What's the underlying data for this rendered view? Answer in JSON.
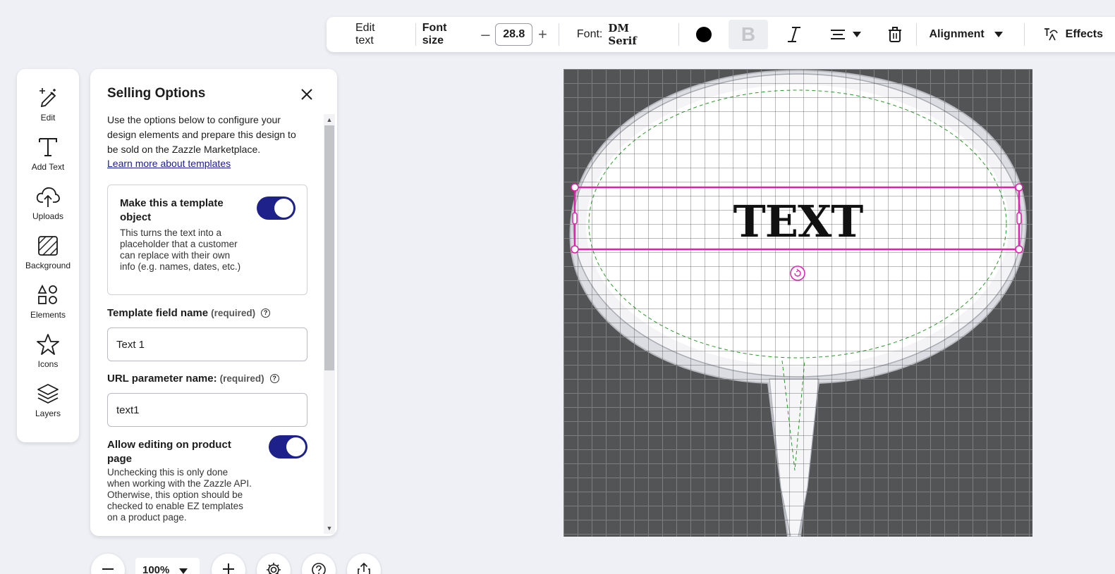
{
  "toolbar": {
    "edit_text": "Edit text",
    "font_size_label": "Font size",
    "font_size_value": "28.8",
    "font_label": "Font:",
    "font_name": "DM Serif",
    "text_color": "#000000",
    "bold_glyph": "B",
    "alignment_label": "Alignment",
    "effects_label": "Effects"
  },
  "rail": {
    "items": [
      {
        "label": "Edit",
        "icon": "edit-sparkle-icon"
      },
      {
        "label": "Add Text",
        "icon": "text-icon"
      },
      {
        "label": "Uploads",
        "icon": "cloud-upload-icon"
      },
      {
        "label": "Background",
        "icon": "background-icon"
      },
      {
        "label": "Elements",
        "icon": "shapes-icon"
      },
      {
        "label": "Icons",
        "icon": "star-icon"
      },
      {
        "label": "Layers",
        "icon": "layers-icon"
      }
    ]
  },
  "panel": {
    "title": "Selling Options",
    "intro": "Use the options below to configure your design elements and prepare this design to be sold on the Zazzle Marketplace.",
    "learn_link": "Learn more about templates",
    "template_toggle": {
      "title": "Make this a template object",
      "description": "This turns the text into a placeholder that a customer can replace with their own info (e.g. names, dates, etc.)",
      "enabled": true
    },
    "template_field": {
      "label": "Template field name",
      "required": "(required)",
      "value": "Text 1"
    },
    "url_param": {
      "label": "URL parameter name:",
      "required": "(required)",
      "value": "text1"
    },
    "allow_editing": {
      "title": "Allow editing on product page",
      "description": "Unchecking this is only done when working with the Zazzle API. Otherwise, this option should be checked to enable EZ templates on a product page.",
      "enabled": true
    }
  },
  "bottom": {
    "zoom": "100%"
  },
  "canvas": {
    "text": "TEXT",
    "selection_color": "#e020b0",
    "accent": "#1d2189"
  }
}
